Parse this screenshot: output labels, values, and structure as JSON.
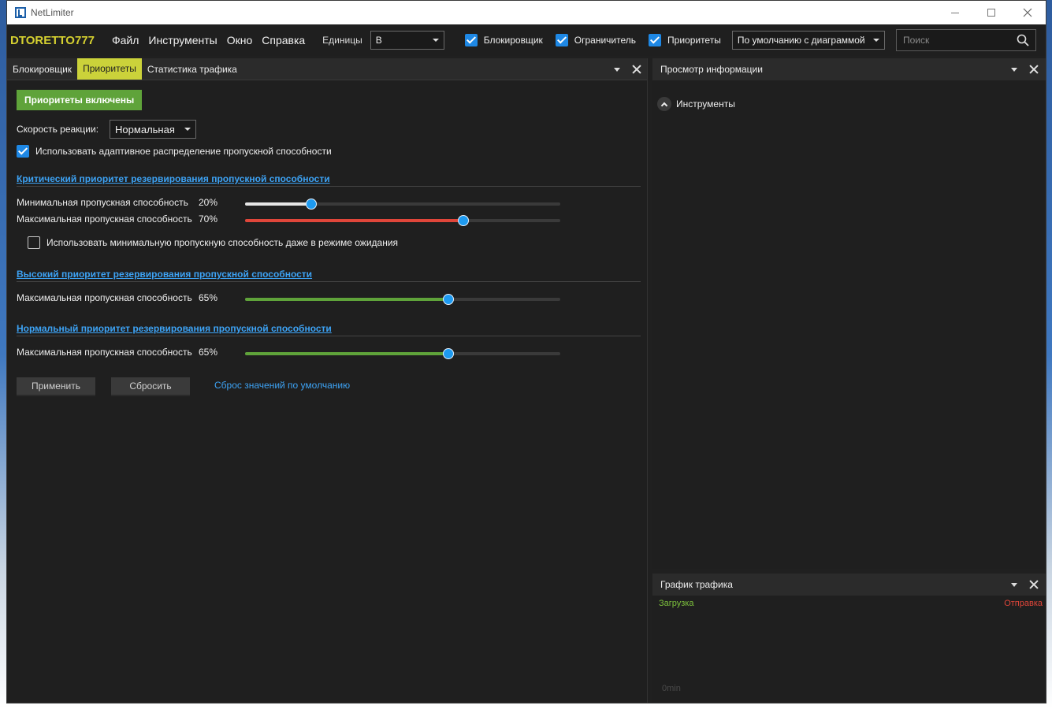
{
  "window": {
    "title": "NetLimiter"
  },
  "menubar": {
    "user": "DTORETTO777",
    "items": [
      "Файл",
      "Инструменты",
      "Окно",
      "Справка"
    ],
    "units_label": "Единицы",
    "units_value": "B",
    "toggles": [
      {
        "label": "Блокировщик",
        "checked": true
      },
      {
        "label": "Ограничитель",
        "checked": true
      },
      {
        "label": "Приоритеты",
        "checked": true
      }
    ],
    "view_mode": "По умолчанию с диаграммой",
    "search_placeholder": "Поиск"
  },
  "left_panel": {
    "tabs": [
      "Блокировщик",
      "Приоритеты",
      "Статистика трафика"
    ],
    "active_tab": "Приоритеты",
    "enabled_button": "Приоритеты включены",
    "reaction_label": "Скорость реакции:",
    "reaction_value": "Нормальная",
    "adaptive_label": "Использовать адаптивное распределение пропускной способности",
    "adaptive_checked": true,
    "critical": {
      "title": "Критический приоритет резервирования пропускной способности",
      "min_label": "Минимальная пропускная способность",
      "min_value": "20%",
      "min_percent": 20,
      "max_label": "Максимальная пропускная способность",
      "max_value": "70%",
      "max_percent": 70,
      "idle_label": "Использовать минимальную пропускную способность даже в режиме ожидания",
      "idle_checked": false
    },
    "high": {
      "title": "Высокий приоритет резервирования пропускной способности",
      "max_label": "Максимальная пропускная способность",
      "max_value": "65%",
      "max_percent": 65
    },
    "normal": {
      "title": "Нормальный приоритет резервирования пропускной способности",
      "max_label": "Максимальная пропускная способность",
      "max_value": "65%",
      "max_percent": 65
    },
    "apply_button": "Применить",
    "reset_button": "Сбросить",
    "defaults_link": "Сброс значений по умолчанию"
  },
  "info_panel": {
    "title": "Просмотр информации",
    "section": "Инструменты"
  },
  "graph_panel": {
    "title": "График трафика",
    "download_label": "Загрузка",
    "upload_label": "Отправка",
    "time_label": "0min"
  },
  "colors": {
    "accent_yellow": "#cbd23a",
    "green": "#5fa33a",
    "blue": "#1e9af0",
    "red": "#e0463a",
    "link": "#3da3f5"
  }
}
